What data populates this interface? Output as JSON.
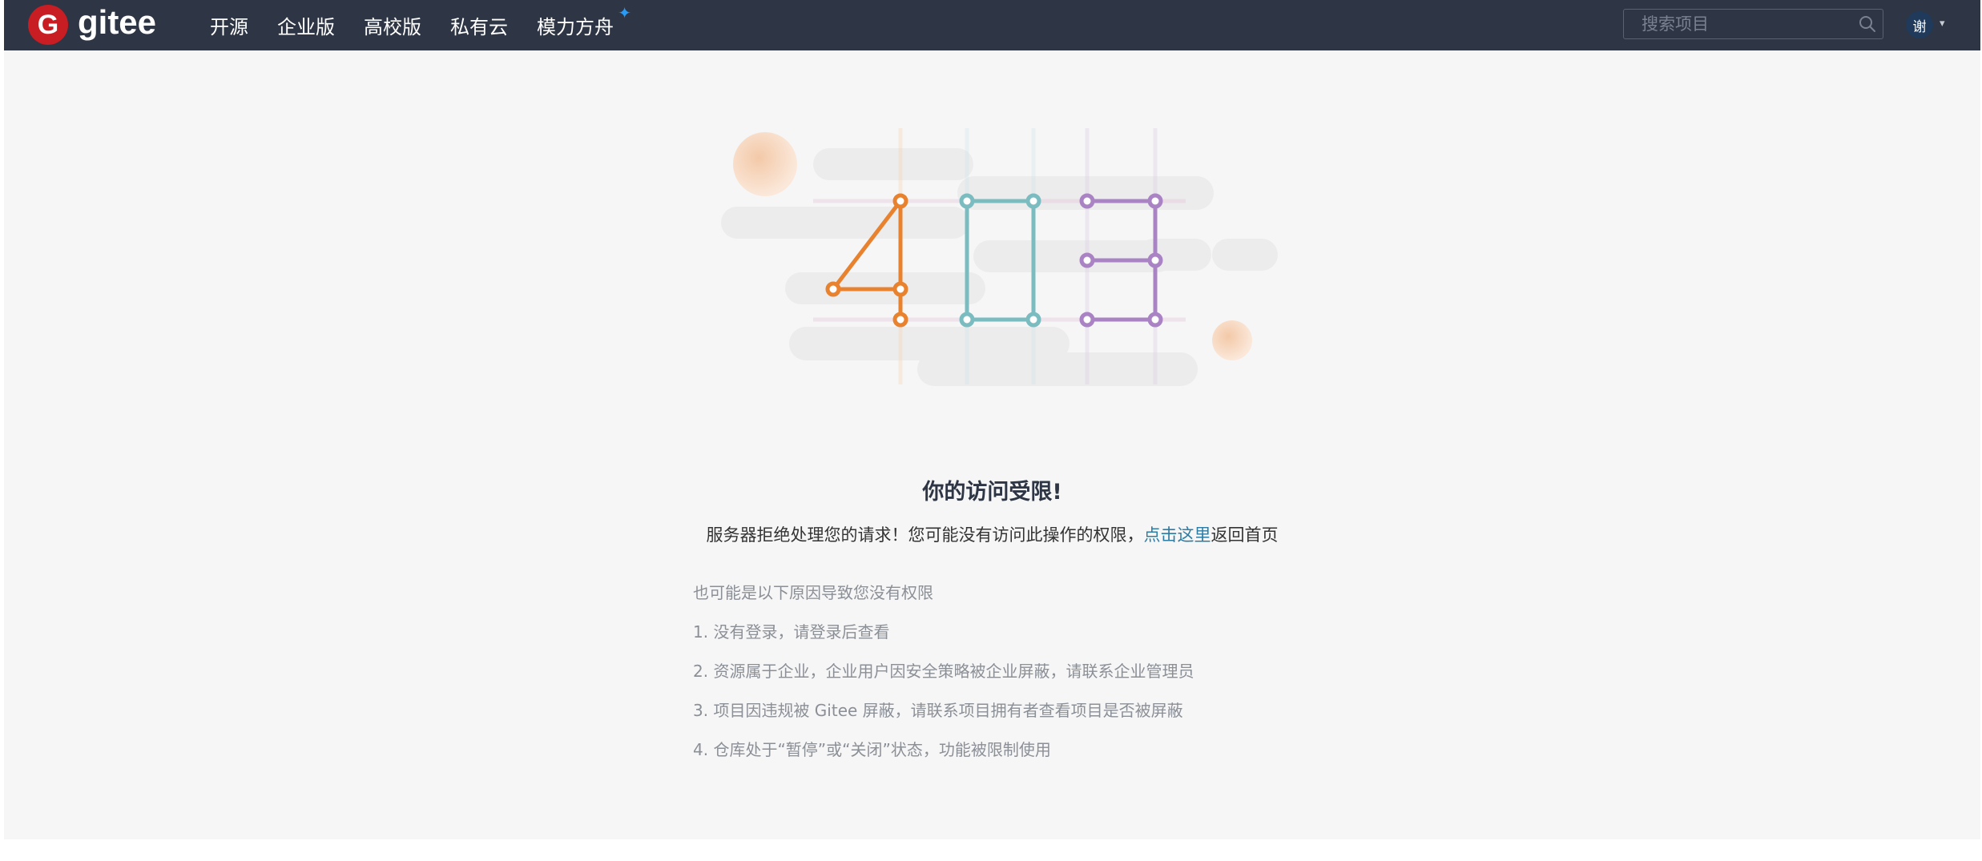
{
  "nav": {
    "brand": "gitee",
    "links": [
      "开源",
      "企业版",
      "高校版",
      "私有云",
      "模力方舟"
    ],
    "star": "✦",
    "search_placeholder": "搜索项目",
    "avatar_text": "谢",
    "avatar_caret": "▾"
  },
  "error": {
    "code": "403",
    "title": "你的访问受限!",
    "message_before": "服务器拒绝处理您的请求！您可能没有访问此操作的权限，",
    "link_text": "点击这里",
    "message_after": "返回首页"
  },
  "reasons": {
    "intro": "也可能是以下原因导致您没有权限",
    "items": [
      "1. 没有登录，请登录后查看",
      "2. 资源属于企业，企业用户因安全策略被企业屏蔽，请联系企业管理员",
      "3. 项目因违规被 Gitee 屏蔽，请联系项目拥有者查看项目是否被屏蔽",
      "4. 仓库处于“暂停”或“关闭”状态，功能被限制使用"
    ]
  },
  "colors": {
    "navbar": "#2e3544",
    "brand_red": "#c71d23",
    "digit_4": "#e8822f",
    "digit_0": "#7bbcc1",
    "digit_3": "#a983c4",
    "link": "#2d7ca3"
  }
}
